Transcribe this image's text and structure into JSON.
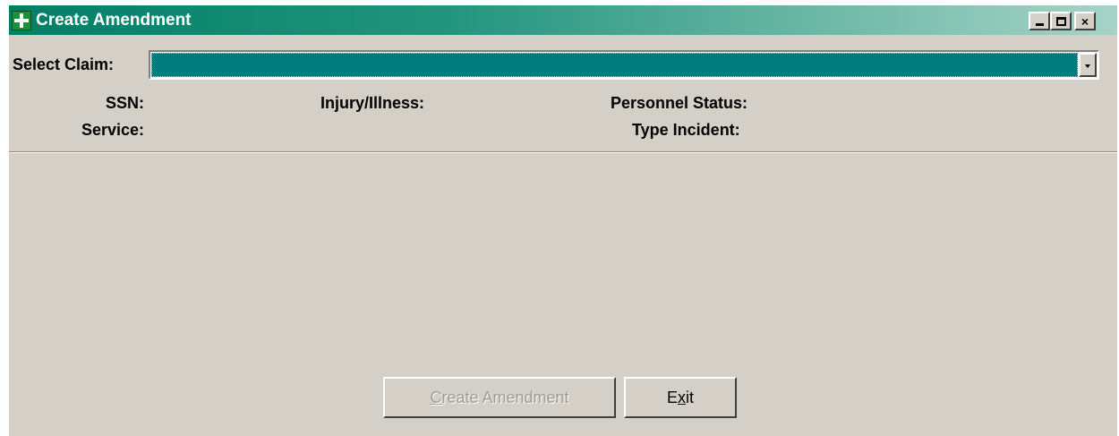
{
  "window": {
    "title": "Create Amendment",
    "controls": {
      "minimize": "_",
      "maximize": "□",
      "close": "×"
    },
    "accent_color": "#007f66"
  },
  "form": {
    "select_claim_label": "Select Claim:",
    "select_claim_value": "",
    "fields": {
      "ssn_label": "SSN:",
      "service_label": "Service:",
      "injury_label": "Injury/Illness:",
      "personnel_status_label": "Personnel Status:",
      "type_incident_label": "Type Incident:"
    }
  },
  "buttons": {
    "create_amendment": {
      "prefix": "C",
      "rest": "reate Amendment",
      "enabled": false
    },
    "exit": {
      "prefix": "E",
      "mid": "x",
      "rest": "it",
      "enabled": true
    }
  },
  "icons": {
    "app": "medical-cross-icon",
    "dropdown": "chevron-down-icon"
  }
}
